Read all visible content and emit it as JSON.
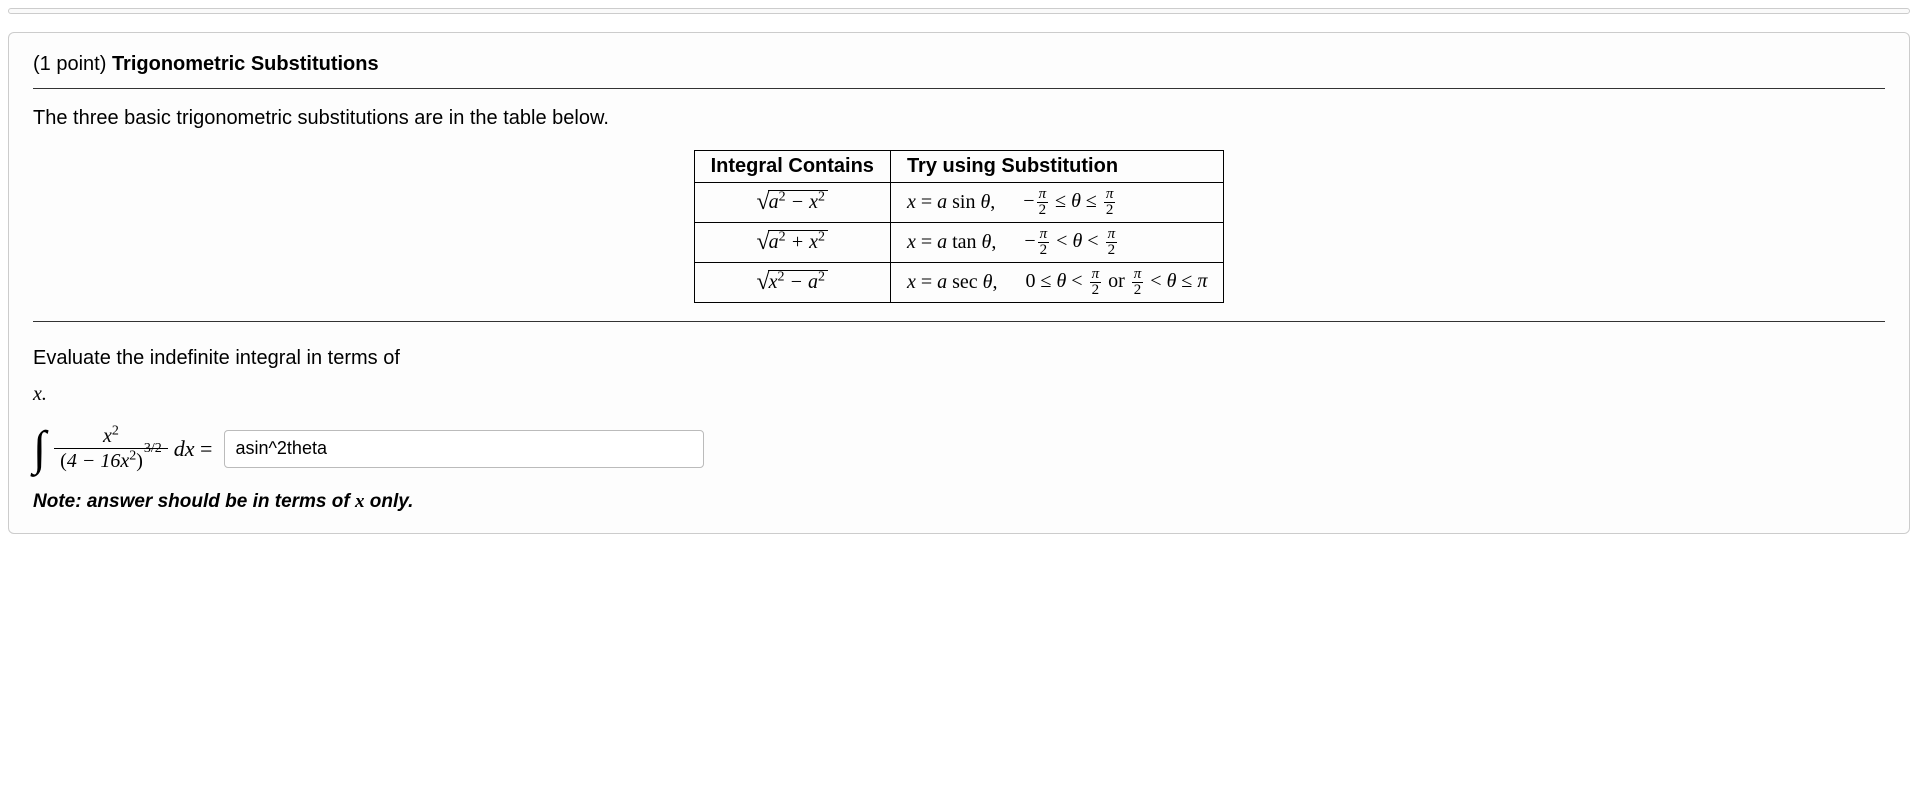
{
  "header": {
    "points": "(1 point)",
    "title": "Trigonometric Substitutions"
  },
  "intro": "The three basic trigonometric substitutions are in the table below.",
  "table": {
    "headers": [
      "Integral Contains",
      "Try using Substitution"
    ],
    "rows": [
      {
        "contains": {
          "a": "a",
          "op": "−",
          "b": "x"
        },
        "sub": "x = a sin θ,",
        "range": "− π/2 ≤ θ ≤ π/2"
      },
      {
        "contains": {
          "a": "a",
          "op": "+",
          "b": "x"
        },
        "sub": "x = a tan θ,",
        "range": "− π/2 < θ < π/2"
      },
      {
        "contains": {
          "a": "x",
          "op": "−",
          "b": "a"
        },
        "sub": "x = a sec θ,",
        "range": "0 ≤ θ < π/2 or π/2 < θ ≤ π"
      }
    ]
  },
  "eval_text_lead": "Evaluate the indefinite integral in terms of",
  "eval_var": "x.",
  "integral": {
    "numerator": "x²",
    "denom_inner": "4 − 16x²",
    "denom_exp": "3/2",
    "dx": "dx =",
    "answer_value": "asin^2theta"
  },
  "note_lead": "Note: answer should be in terms of",
  "note_var": "x",
  "note_tail": "only."
}
